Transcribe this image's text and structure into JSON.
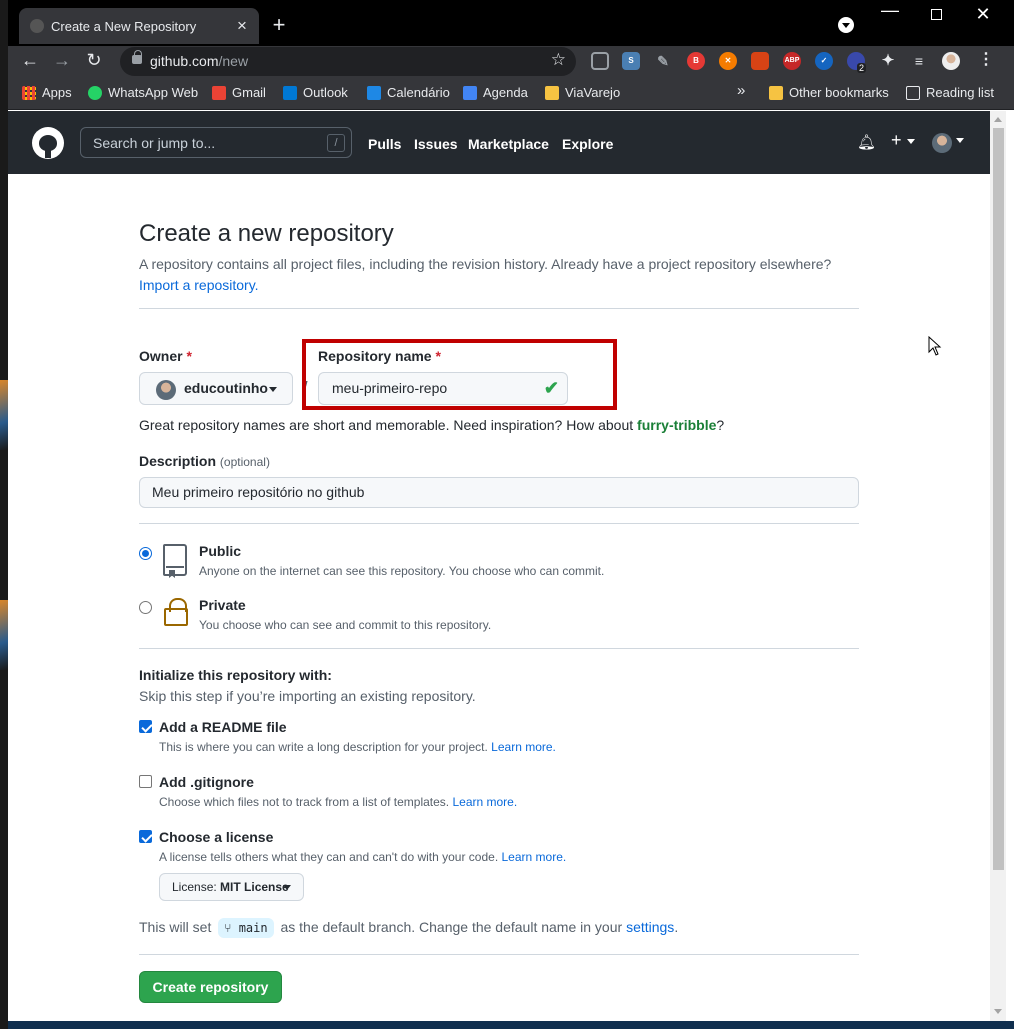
{
  "browser": {
    "tab_title": "Create a New Repository",
    "url_host": "github.com",
    "url_path": "/new",
    "bookmarks": [
      "Apps",
      "WhatsApp Web",
      "Gmail",
      "Outlook",
      "Calendário",
      "Agenda",
      "ViaVarejo"
    ],
    "other_bookmarks": "Other bookmarks",
    "reading_list": "Reading list",
    "overflow": "»",
    "ext_badge": "2"
  },
  "github": {
    "search_placeholder": "Search or jump to...",
    "search_key": "/",
    "nav": [
      "Pulls",
      "Issues",
      "Marketplace",
      "Explore"
    ]
  },
  "page": {
    "title": "Create a new repository",
    "subtitle": "A repository contains all project files, including the revision history. Already have a project repository elsewhere?",
    "import_link": "Import a repository.",
    "owner_label": "Owner",
    "required_mark": "*",
    "owner_value": "educoutinho",
    "separator": "/",
    "repo_label": "Repository name",
    "repo_value": "meu-primeiro-repo",
    "hint_text": "Great repository names are short and memorable. Need inspiration? How about",
    "hint_suggestion": "furry-tribble",
    "hint_end": "?",
    "description_label": "Description",
    "description_optional": "(optional)",
    "description_value": "Meu primeiro repositório no github",
    "public_title": "Public",
    "public_note": "Anyone on the internet can see this repository. You choose who can commit.",
    "private_title": "Private",
    "private_note": "You choose who can see and commit to this repository.",
    "init_title": "Initialize this repository with:",
    "init_note": "Skip this step if you’re importing an existing repository.",
    "readme_title": "Add a README file",
    "readme_note": "This is where you can write a long description for your project.",
    "gitignore_title": "Add .gitignore",
    "gitignore_note": "Choose which files not to track from a list of templates.",
    "license_title": "Choose a license",
    "license_note": "A license tells others what they can and can't do with your code.",
    "learn_more": "Learn more.",
    "license_prefix": "License:",
    "license_value": "MIT License",
    "branch_pre": "This will set",
    "branch_name": "main",
    "branch_post": "as the default branch. Change the default name in your",
    "settings_link": "settings",
    "period": ".",
    "create_button": "Create repository"
  },
  "state": {
    "visibility": "public",
    "readme_checked": true,
    "gitignore_checked": false,
    "license_checked": true
  }
}
